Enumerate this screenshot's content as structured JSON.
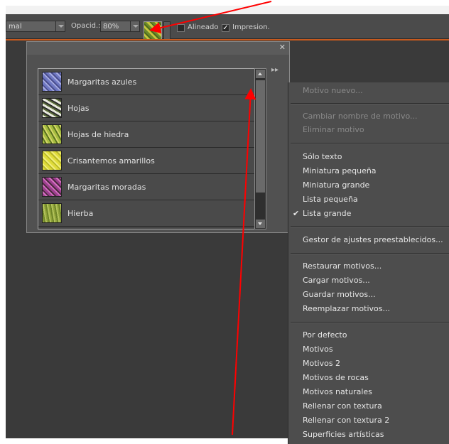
{
  "options_bar": {
    "mode_value": "mal",
    "opacity_label": "Opacid.:",
    "opacity_value": "80%",
    "aligned_label": "Alineado",
    "impression_label": "Impresion."
  },
  "pattern_list": [
    {
      "label": "Margaritas azules",
      "thumb_color": "#7b82c7"
    },
    {
      "label": "Hojas",
      "thumb_color": "#d7d7c9"
    },
    {
      "label": "Hojas de hiedra",
      "thumb_color": "#9fb33d"
    },
    {
      "label": "Crisantemos amarillos",
      "thumb_color": "#d8d63b"
    },
    {
      "label": "Margaritas moradas",
      "thumb_color": "#9a4a8f"
    },
    {
      "label": "Hierba",
      "thumb_color": "#8f9f3a"
    }
  ],
  "menu": {
    "new_pattern": "Motivo nuevo...",
    "rename_pattern": "Cambiar nombre de motivo...",
    "delete_pattern": "Eliminar motivo",
    "text_only": "Sólo texto",
    "small_thumb": "Miniatura pequeña",
    "large_thumb": "Miniatura grande",
    "small_list": "Lista pequeña",
    "large_list": "Lista grande",
    "preset_manager": "Gestor de ajustes preestablecidos...",
    "restore": "Restaurar motivos...",
    "load": "Cargar motivos...",
    "save": "Guardar motivos...",
    "replace": "Reemplazar motivos...",
    "default": "Por defecto",
    "motivos": "Motivos",
    "motivos2": "Motivos 2",
    "rocks": "Motivos de rocas",
    "natural": "Motivos naturales",
    "fill_texture": "Rellenar con textura",
    "fill_texture2": "Rellenar con textura 2",
    "artistic": "Superficies artísticas"
  },
  "colors": {
    "accent_line": "#c85a1e",
    "annotation_arrow": "#ff0000"
  }
}
